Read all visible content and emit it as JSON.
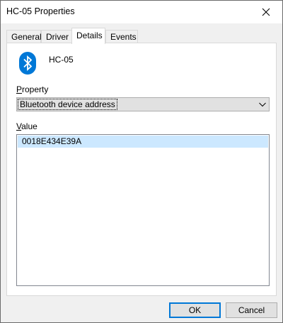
{
  "window": {
    "title": "HC-05 Properties"
  },
  "tabs": [
    {
      "label": "General"
    },
    {
      "label": "Driver"
    },
    {
      "label": "Details"
    },
    {
      "label": "Events"
    }
  ],
  "active_tab": "Details",
  "device": {
    "name": "HC-05",
    "icon": "bluetooth-icon",
    "icon_color": "#0078d7"
  },
  "property": {
    "label": "Property",
    "selected": "Bluetooth device address"
  },
  "value": {
    "label": "Value",
    "items": [
      "0018E434E39A"
    ]
  },
  "buttons": {
    "ok": "OK",
    "cancel": "Cancel"
  }
}
